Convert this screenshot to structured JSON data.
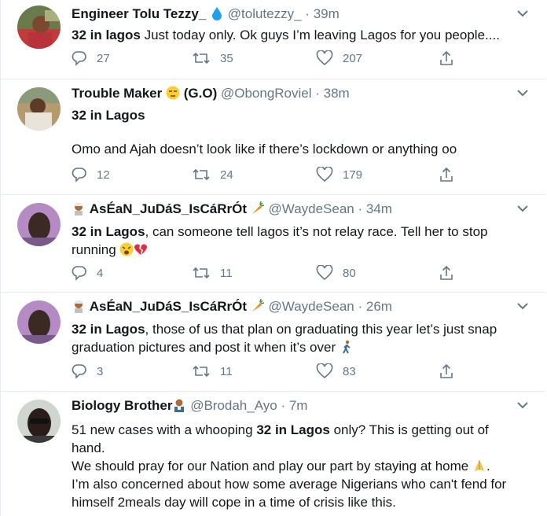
{
  "tweets": [
    {
      "name": "Engineer Tolu Tezzy_",
      "handle": "@tolutezzy_",
      "time": "39m",
      "body_bold": "32 in lagos",
      "body_rest": " Just today only. Ok guys I’m leaving Lagos for you people....",
      "replies": "27",
      "retweets": "35",
      "likes": "207"
    },
    {
      "name": "Trouble Maker",
      "name_suffix": "(G.O)",
      "handle": "@ObongRoviel",
      "time": "38m",
      "body_bold": "32 in Lagos",
      "body_line2": "Omo and Ajah doesn’t look like if there’s lockdown or anything oo",
      "replies": "12",
      "retweets": "24",
      "likes": "179"
    },
    {
      "name": "AsÉaN_JuDáS_IsCáRrÓt",
      "handle": "@WaydeSean",
      "time": "34m",
      "body_bold": "32 in Lagos",
      "body_rest": ", can someone tell lagos it’s not relay race. Tell her to stop",
      "body_line2": "running",
      "replies": "4",
      "retweets": "11",
      "likes": "80"
    },
    {
      "name": "AsÉaN_JuDáS_IsCáRrÓt",
      "handle": "@WaydeSean",
      "time": "26m",
      "body_bold": "32 in Lagos",
      "body_rest": ", those of us that plan on graduating this year let’s just snap",
      "body_line2": "graduation pictures and post it when it’s over",
      "replies": "3",
      "retweets": "11",
      "likes": "83"
    },
    {
      "name": "Biology Brother",
      "handle": "@Brodah_Ayo",
      "time": "7m",
      "body_pre": "51 new cases with a whooping ",
      "body_bold": "32 in Lagos",
      "body_rest": " only? This is getting out of",
      "body_line2": "hand.",
      "body_line3": "We should pray for our Nation and play our part by staying at home",
      "body_line3_end": ".",
      "body_line4": "I’m also concerned about how some average Nigerians who can't fend for",
      "body_line5": "himself 2meals day will cope in a time of crisis like this."
    }
  ],
  "separator": " · ",
  "icons": {
    "reply": "reply-icon",
    "retweet": "retweet-icon",
    "like": "like-icon",
    "share": "share-icon",
    "verified_drop": "water-drop-emoji",
    "chevron": "chevron-down-icon"
  },
  "colors": {
    "name": "#14171a",
    "secondary": "#657786",
    "border": "#e6ecf0",
    "drop": "#1da1f2"
  }
}
